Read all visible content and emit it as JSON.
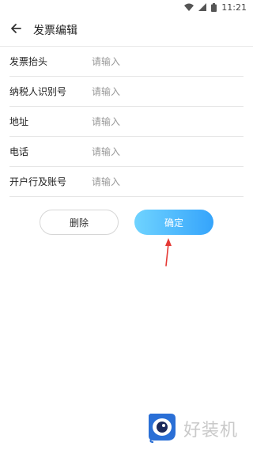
{
  "status_bar": {
    "time": "11:21",
    "icons": [
      "wifi-icon",
      "signal-icon",
      "battery-icon"
    ]
  },
  "header": {
    "title": "发票编辑",
    "back_icon": "arrow-left-icon"
  },
  "form": {
    "fields": [
      {
        "label": "发票抬头",
        "placeholder": "请输入",
        "value": ""
      },
      {
        "label": "纳税人识别号",
        "placeholder": "请输入",
        "value": ""
      },
      {
        "label": "地址",
        "placeholder": "请输入",
        "value": ""
      },
      {
        "label": "电话",
        "placeholder": "请输入",
        "value": ""
      },
      {
        "label": "开户行及账号",
        "placeholder": "请输入",
        "value": ""
      }
    ]
  },
  "actions": {
    "delete_label": "删除",
    "confirm_label": "确定"
  },
  "watermark": {
    "text": "好装机"
  },
  "colors": {
    "confirm_gradient_start": "#6fd3ff",
    "confirm_gradient_end": "#35a4fb",
    "annotation_arrow": "#e53935",
    "placeholder": "#9a9a9a"
  }
}
